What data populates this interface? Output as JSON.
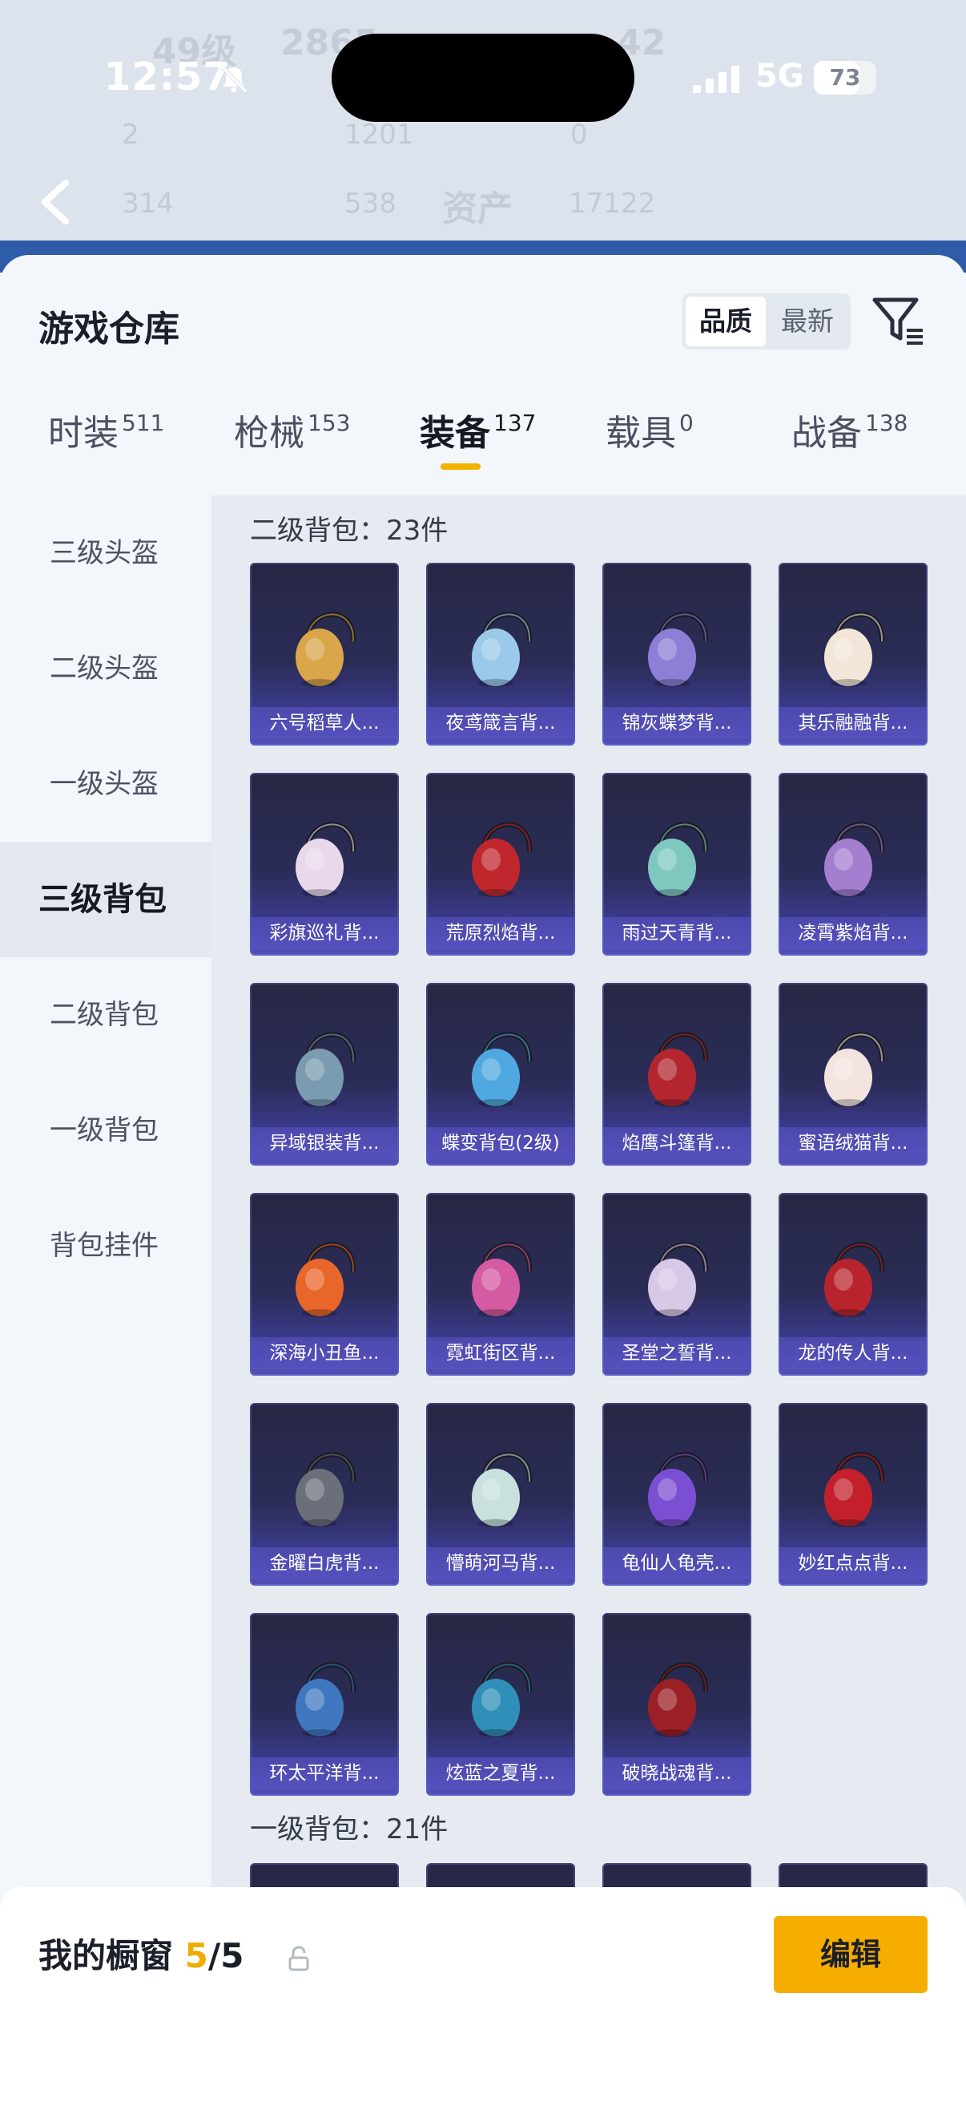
{
  "status_bar": {
    "time": "12:57",
    "network": "5G",
    "battery": "73",
    "battery_level": 0.73
  },
  "bg_header": {
    "level": "49级",
    "points": "2865",
    "right_value": "42",
    "row1": [
      "2",
      "1201",
      "0"
    ],
    "row2": [
      "314",
      "538"
    ],
    "assets_label": "资产",
    "assets_value": "17122"
  },
  "sheet": {
    "title": "游戏仓库",
    "sort": {
      "quality": "品质",
      "latest": "最新"
    }
  },
  "tabs": [
    {
      "label": "时装",
      "count": "511"
    },
    {
      "label": "枪械",
      "count": "153"
    },
    {
      "label": "装备",
      "count": "137"
    },
    {
      "label": "载具",
      "count": "0"
    },
    {
      "label": "战备",
      "count": "138"
    }
  ],
  "sidebar": [
    "三级头盔",
    "二级头盔",
    "一级头盔",
    "三级背包",
    "二级背包",
    "一级背包",
    "背包挂件"
  ],
  "section_level2": "二级背包：23件",
  "section_level1": "一级背包：21件",
  "items": [
    {
      "label": "六号稻草人...",
      "icon": "scarecrow-backpack",
      "color": "#d9a64a"
    },
    {
      "label": "夜鸢箴言背...",
      "icon": "flower-charm-backpack",
      "color": "#9bc9ea"
    },
    {
      "label": "锦灰蝶梦背...",
      "icon": "diamond-charm-backpack",
      "color": "#8b7fd6"
    },
    {
      "label": "其乐融融背...",
      "icon": "cake-backpack",
      "color": "#f2e6d8"
    },
    {
      "label": "彩旗巡礼背...",
      "icon": "gift-backpack",
      "color": "#e8d8ec"
    },
    {
      "label": "荒原烈焰背...",
      "icon": "red-helmet-backpack",
      "color": "#c0272d"
    },
    {
      "label": "雨过天青背...",
      "icon": "jade-charm-backpack",
      "color": "#7fc8c0"
    },
    {
      "label": "凌霄紫焰背...",
      "icon": "purple-gem-backpack",
      "color": "#a47fd0"
    },
    {
      "label": "异域银装背...",
      "icon": "silver-box-backpack",
      "color": "#7a9bb0"
    },
    {
      "label": "蝶变背包(2级)",
      "icon": "butterfly-backpack",
      "color": "#4fa9e0"
    },
    {
      "label": "焰鹰斗篷背...",
      "icon": "hawk-cloak-backpack",
      "color": "#b3262f"
    },
    {
      "label": "蜜语绒猫背...",
      "icon": "cat-backpack",
      "color": "#f3e4e0"
    },
    {
      "label": "深海小丑鱼...",
      "icon": "clownfish-backpack",
      "color": "#e8662a"
    },
    {
      "label": "霓虹街区背...",
      "icon": "neon-pink-backpack",
      "color": "#d45aa2"
    },
    {
      "label": "圣堂之誓背...",
      "icon": "holy-wing-backpack",
      "color": "#d8c8e8"
    },
    {
      "label": "龙的传人背...",
      "icon": "dragon-red-backpack",
      "color": "#b8242c"
    },
    {
      "label": "金曜白虎背...",
      "icon": "white-tiger-backpack",
      "color": "#6b6f7a"
    },
    {
      "label": "懵萌河马背...",
      "icon": "hippo-backpack",
      "color": "#c8e0de"
    },
    {
      "label": "龟仙人龟壳...",
      "icon": "turtle-shell-backpack",
      "color": "#7b4fd2"
    },
    {
      "label": "妙红点点背...",
      "icon": "ladybug-backpack",
      "color": "#c3202b"
    },
    {
      "label": "环太平洋背...",
      "icon": "mecha-backpack",
      "color": "#3f78c0"
    },
    {
      "label": "炫蓝之夏背...",
      "icon": "blue-camo-backpack",
      "color": "#2f8fb8"
    },
    {
      "label": "破晓战魂背...",
      "icon": "dawn-warrior-backpack",
      "color": "#9a1f26"
    }
  ],
  "bottom_bar": {
    "title": "我的橱窗",
    "count": "5",
    "total": "/5",
    "edit": "编辑"
  },
  "colors": {
    "accent": "#f5a800",
    "card_top": "#262744",
    "card_bottom": "#5150b8"
  }
}
